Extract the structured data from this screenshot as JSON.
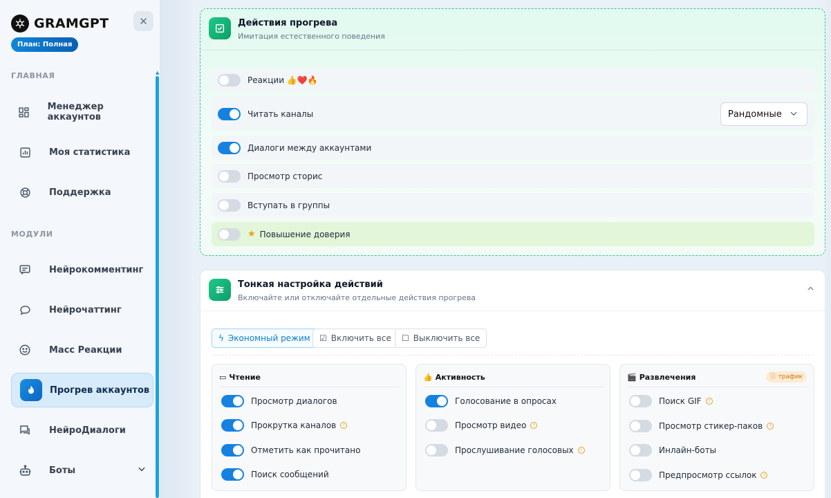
{
  "sidebar": {
    "brand": "GRAMGPT",
    "plan": "План: Полная",
    "section_main": "ГЛАВНАЯ",
    "section_modules": "МОДУЛИ",
    "items": [
      {
        "label": "Менеджер аккаунтов",
        "icon": "grid-icon"
      },
      {
        "label": "Моя статистика",
        "icon": "chart-icon"
      },
      {
        "label": "Поддержка",
        "icon": "lifebuoy-icon"
      },
      {
        "label": "Нейрокомментинг",
        "icon": "comment-icon"
      },
      {
        "label": "Нейрочаттинг",
        "icon": "chat-bubble-icon"
      },
      {
        "label": "Масс Реакции",
        "icon": "smile-icon"
      },
      {
        "label": "Прогрев аккаунтов",
        "icon": "fire-icon",
        "active": true
      },
      {
        "label": "НейроДиалоги",
        "icon": "dialogs-icon"
      },
      {
        "label": "Боты",
        "icon": "robot-icon"
      }
    ]
  },
  "warmup": {
    "title": "Действия прогрева",
    "subtitle": "Имитация естественного поведения",
    "rows": [
      {
        "label": "Реакции 👍❤️🔥",
        "on": false
      },
      {
        "label": "Читать каналы",
        "on": true
      },
      {
        "label": "Диалоги между аккаунтами",
        "on": true
      },
      {
        "label": "Просмотр сторис",
        "on": false
      },
      {
        "label": "Вступать в группы",
        "on": false
      },
      {
        "label": "Повышение доверия",
        "on": false
      }
    ],
    "channel_mode": "Рандомные"
  },
  "fine": {
    "title": "Тонкая настройка действий",
    "subtitle": "Включайте или отключайте отдельные действия прогрева",
    "btn_eco": "Экономный режим",
    "btn_all_on": "Включить все",
    "btn_all_off": "Выключить все",
    "columns": [
      {
        "title": "Чтение",
        "items": [
          {
            "label": "Просмотр диалогов",
            "on": true,
            "warn": false
          },
          {
            "label": "Прокрутка каналов",
            "on": true,
            "warn": true
          },
          {
            "label": "Отметить как прочитано",
            "on": true,
            "warn": false
          },
          {
            "label": "Поиск сообщений",
            "on": true,
            "warn": false
          }
        ]
      },
      {
        "title": "Активность",
        "items": [
          {
            "label": "Голосование в опросах",
            "on": true,
            "warn": false
          },
          {
            "label": "Просмотр видео",
            "on": false,
            "warn": true
          },
          {
            "label": "Прослушивание голосовых",
            "on": false,
            "warn": true
          }
        ]
      },
      {
        "title": "Развлечения",
        "badge": "трафик",
        "items": [
          {
            "label": "Поиск GIF",
            "on": false,
            "warn": true
          },
          {
            "label": "Просмотр стикер-паков",
            "on": false,
            "warn": true
          },
          {
            "label": "Инлайн-боты",
            "on": false,
            "warn": false
          },
          {
            "label": "Предпросмотр ссылок",
            "on": false,
            "warn": true
          }
        ]
      }
    ]
  },
  "colors": {
    "accent": "#1581e0",
    "green": "#10b981",
    "warning": "#e8a21c"
  }
}
